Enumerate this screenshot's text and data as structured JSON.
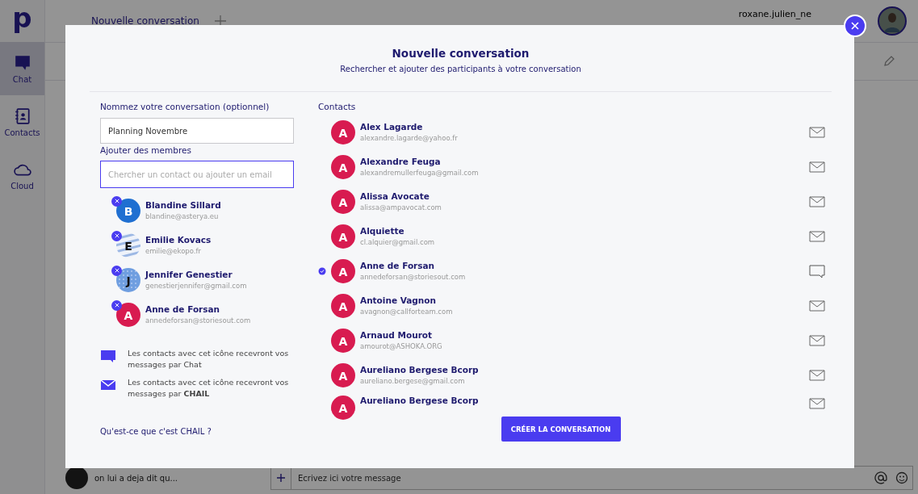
{
  "app": {
    "logo": "p",
    "nav": [
      {
        "label": "Chat",
        "kind": "chat",
        "selected": true
      },
      {
        "label": "Contacts",
        "kind": "contacts",
        "selected": false
      },
      {
        "label": "Cloud",
        "kind": "cloud",
        "selected": false
      }
    ],
    "tab": "Nouvelle conversation",
    "username": "roxane.julien_ne",
    "preview": "on lui a deja dit qu...",
    "composer": {
      "placeholder": "Ecrivez ici votre message"
    }
  },
  "dialog": {
    "title": "Nouvelle conversation",
    "subtitle": "Rechercher et ajouter des participants à votre conversation",
    "name_label": "Nommez votre conversation (optionnel)",
    "name_value": "Planning Novembre",
    "members_label": "Ajouter des membres",
    "search": {
      "placeholder": "Chercher un contact ou ajouter un email"
    },
    "members": [
      {
        "initial": "B",
        "name": "Blandine Sillard",
        "email": "blandine@asterya.eu",
        "kind": "plain",
        "color": "#1f6fd1"
      },
      {
        "initial": "E",
        "name": "Emilie Kovacs",
        "email": "emilie@ekopo.fr",
        "kind": "stripes",
        "color": "#9db8e4"
      },
      {
        "initial": "J",
        "name": "Jennifer Genestier",
        "email": "genestierjennifer@gmail.com",
        "kind": "dots",
        "color": "#6f9ee0"
      },
      {
        "initial": "A",
        "name": "Anne de Forsan",
        "email": "annedeforsan@storiesout.com",
        "kind": "plain",
        "color": "#d81b50"
      }
    ],
    "legend": [
      {
        "kind": "chat",
        "text": "Les contacts avec cet icône recevront vos messages par Chat"
      },
      {
        "kind": "mail",
        "text": "Les contacts avec cet icône recevront vos messages par **CHAIL**"
      }
    ],
    "help_link": "Qu'est-ce que c'est CHAIL ?",
    "contacts_label": "Contacts",
    "contacts": [
      {
        "initial": "A",
        "name": "Alex Lagarde",
        "email": "alexandre.lagarde@yahoo.fr",
        "kind": "mail",
        "selected": false
      },
      {
        "initial": "A",
        "name": "Alexandre Feuga",
        "email": "alexandremullerfeuga@gmail.com",
        "kind": "mail",
        "selected": false
      },
      {
        "initial": "A",
        "name": "Alissa Avocate",
        "email": "alissa@ampavocat.com",
        "kind": "mail",
        "selected": false
      },
      {
        "initial": "A",
        "name": "Alquiette",
        "email": "cl.alquier@gmail.com",
        "kind": "mail",
        "selected": false
      },
      {
        "initial": "A",
        "name": "Anne de Forsan",
        "email": "annedeforsan@storiesout.com",
        "kind": "chat",
        "selected": true
      },
      {
        "initial": "A",
        "name": "Antoine Vagnon",
        "email": "avagnon@callforteam.com",
        "kind": "mail",
        "selected": false
      },
      {
        "initial": "A",
        "name": "Arnaud Mourot",
        "email": "amourot@ASHOKA.ORG",
        "kind": "mail",
        "selected": false
      },
      {
        "initial": "A",
        "name": "Aureliano Bergese Bcorp",
        "email": "aureliano.bergese@gmail.com",
        "kind": "mail",
        "selected": false
      },
      {
        "initial": "A",
        "name": "Aureliano Bergese Bcorp",
        "kind": "mail",
        "selected": false
      }
    ],
    "create_button": "CRÉER LA CONVERSATION"
  }
}
